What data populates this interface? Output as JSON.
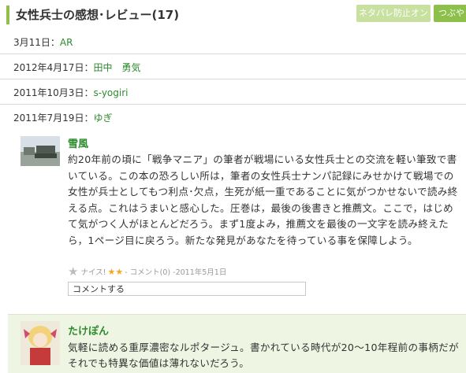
{
  "header": {
    "title": "女性兵士の感想･レビュー(17)",
    "spoiler_button": "ネタバレ防止オン",
    "tweet_button": "つぶやき"
  },
  "short_reviews": [
    {
      "date": "3月11日：",
      "user": "AR"
    },
    {
      "date": "2012年4月17日：",
      "user": "田中　勇気"
    },
    {
      "date": "2011年10月3日：",
      "user": "s-yogiri"
    },
    {
      "date": "2011年7月19日：",
      "user": "ゆぎ"
    }
  ],
  "review": {
    "user": "雪風",
    "body": "約20年前の頃に「戦争マニア」の筆者が戦場にいる女性兵士との交流を軽い筆致で書いている。この本の恐ろしい所は，筆者の女性兵士ナンパ記録にみせかけて戦場での女性が兵士としてもつ利点･欠点，生死が紙一重であることに気がつかせないで読み終える点。これはうまいと感心した。圧巻は，最後の後書きと推薦文。ここで，はじめて気がつく人がほとんどだろう。まず1度よみ，推薦文を最後の一文字を読み終えたら，1ページ目に戻ろう。新たな発見があなたを待っている事を保障しよう。",
    "nice_label": "ナイス!",
    "stars": "★★",
    "comment_count": " - コメント(0) - ",
    "date": "2011年5月1日",
    "comment_button": "コメントする"
  },
  "review2": {
    "user": "たけぽん",
    "body": "気軽に読める重厚濃密なルポタージュ。書かれている時代が20～10年程前の事柄だがそれでも特異な価値は薄れないだろう。"
  },
  "colors": {
    "accent": "#2e8b2e",
    "bar": "#8fbf4d",
    "tweet": "#8cc04a",
    "panel": "#eef6e3"
  }
}
